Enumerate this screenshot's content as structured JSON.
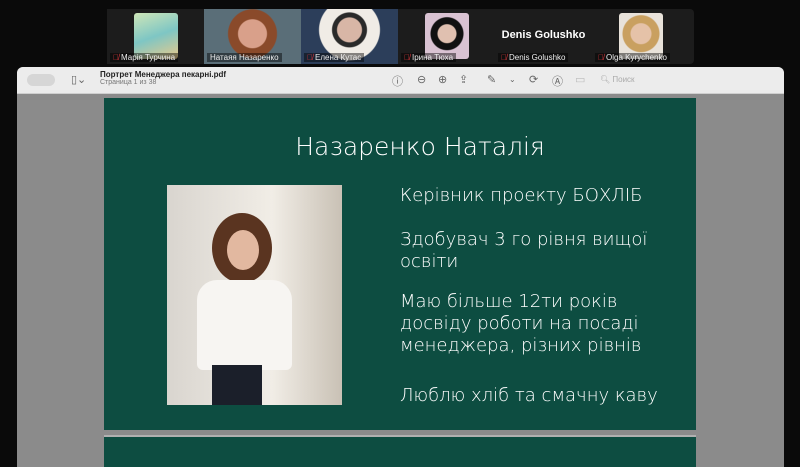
{
  "participants": [
    {
      "name": "Марія Турчина",
      "muted": true
    },
    {
      "name": "Натаяя Назаренко",
      "muted": false,
      "active": true
    },
    {
      "name": "Елена Кутас",
      "muted": true
    },
    {
      "name": "Ірина Тюха",
      "muted": true
    },
    {
      "name": "Denis Golushko",
      "muted": true,
      "display": "Denis Golushko"
    },
    {
      "name": "Olga Kyrychenko",
      "muted": true
    }
  ],
  "viewer": {
    "file_name": "Портрет Менеджера пекарні.pdf",
    "page_info": "Страница 1 из 38",
    "search_placeholder": "Поиск"
  },
  "slide": {
    "title": "Назаренко Наталія",
    "lines": [
      "Керівник проекту БОХЛІБ",
      "Здобувач 3 го рівня вищої освіти",
      "Маю більше 12ти років досвіду роботи на посаді менеджера, різних рівнів",
      "Люблю хліб та смачну каву"
    ]
  }
}
